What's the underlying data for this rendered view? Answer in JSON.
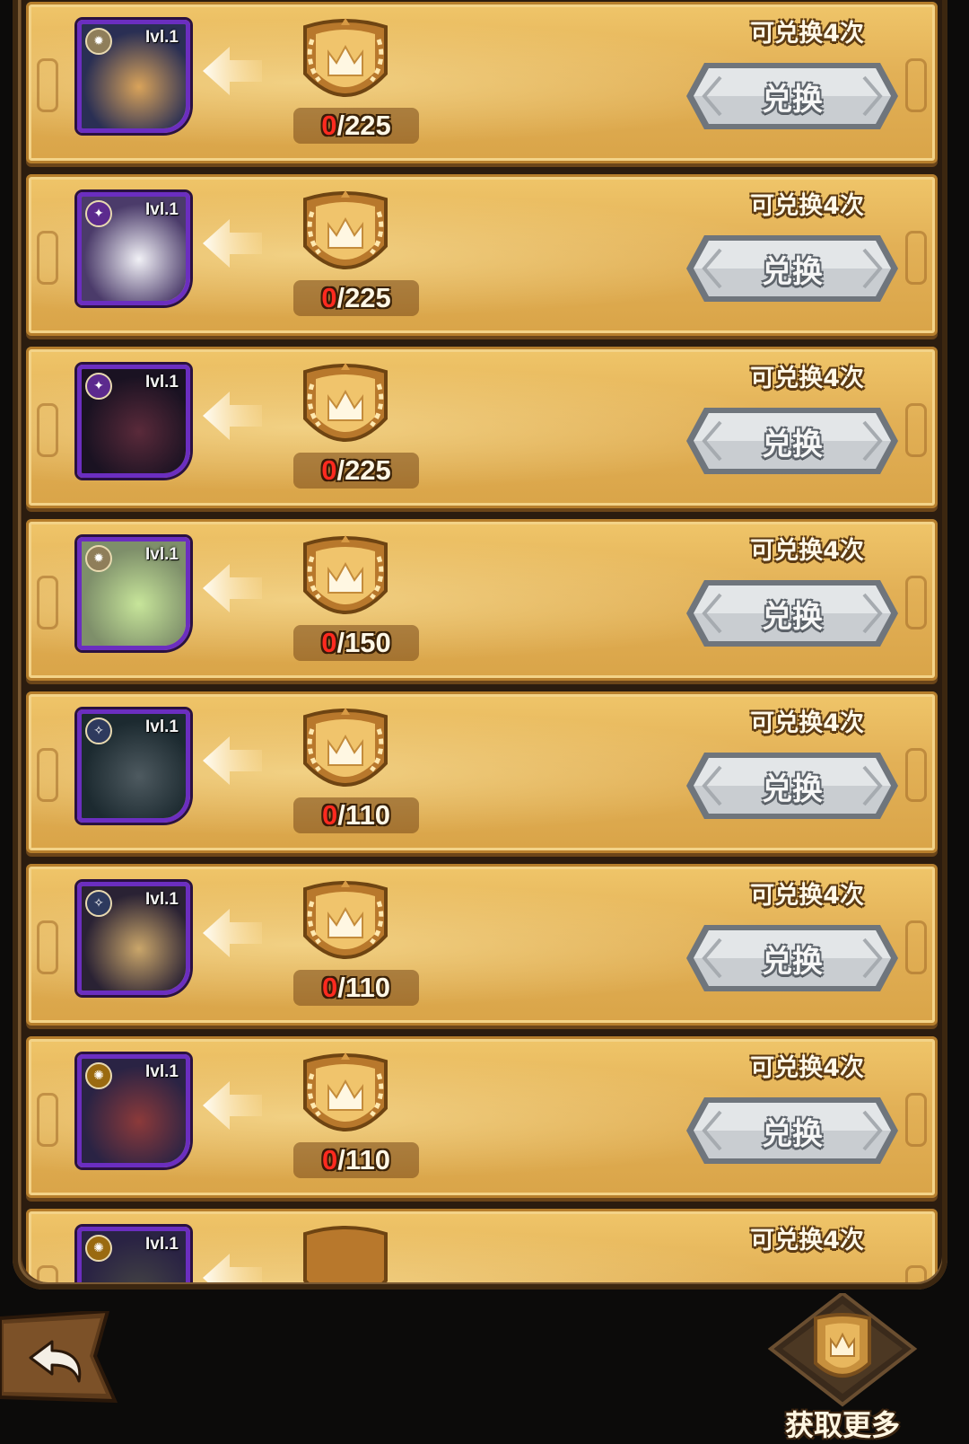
{
  "rows": [
    {
      "level": "Ivl.1",
      "current": "0",
      "required": "225",
      "times_label": "可兑换4次",
      "button_label": "兑换",
      "faction": "light",
      "art_colors": [
        "#2a2f54",
        "#d9a35a"
      ]
    },
    {
      "level": "Ivl.1",
      "current": "0",
      "required": "225",
      "times_label": "可兑换4次",
      "button_label": "兑换",
      "faction": "dark",
      "art_colors": [
        "#4b3b6a",
        "#f1f1f6"
      ]
    },
    {
      "level": "Ivl.1",
      "current": "0",
      "required": "225",
      "times_label": "可兑换4次",
      "button_label": "兑换",
      "faction": "dark",
      "art_colors": [
        "#1a1222",
        "#5a2a3a"
      ]
    },
    {
      "level": "Ivl.1",
      "current": "0",
      "required": "150",
      "times_label": "可兑换4次",
      "button_label": "兑换",
      "faction": "light",
      "art_colors": [
        "#7e8f6a",
        "#c7e59a"
      ]
    },
    {
      "level": "Ivl.1",
      "current": "0",
      "required": "110",
      "times_label": "可兑换4次",
      "button_label": "兑换",
      "faction": "star",
      "art_colors": [
        "#1c2a30",
        "#4e5a60"
      ]
    },
    {
      "level": "Ivl.1",
      "current": "0",
      "required": "110",
      "times_label": "可兑换4次",
      "button_label": "兑换",
      "faction": "star",
      "art_colors": [
        "#2a2234",
        "#caa66a"
      ]
    },
    {
      "level": "Ivl.1",
      "current": "0",
      "required": "110",
      "times_label": "可兑换4次",
      "button_label": "兑换",
      "faction": "sun",
      "art_colors": [
        "#2a2344",
        "#8c3a3a"
      ]
    },
    {
      "level": "Ivl.1",
      "current": "",
      "required": "",
      "times_label": "可兑换4次",
      "button_label": "",
      "faction": "sun",
      "art_colors": [
        "#2a2344",
        "#444"
      ]
    }
  ],
  "bottom": {
    "get_more_label": "获取更多"
  },
  "colors": {
    "row_gold": "#e2b056",
    "portrait_border": "#6b2ec0",
    "progress_red": "#ff2a1f"
  }
}
